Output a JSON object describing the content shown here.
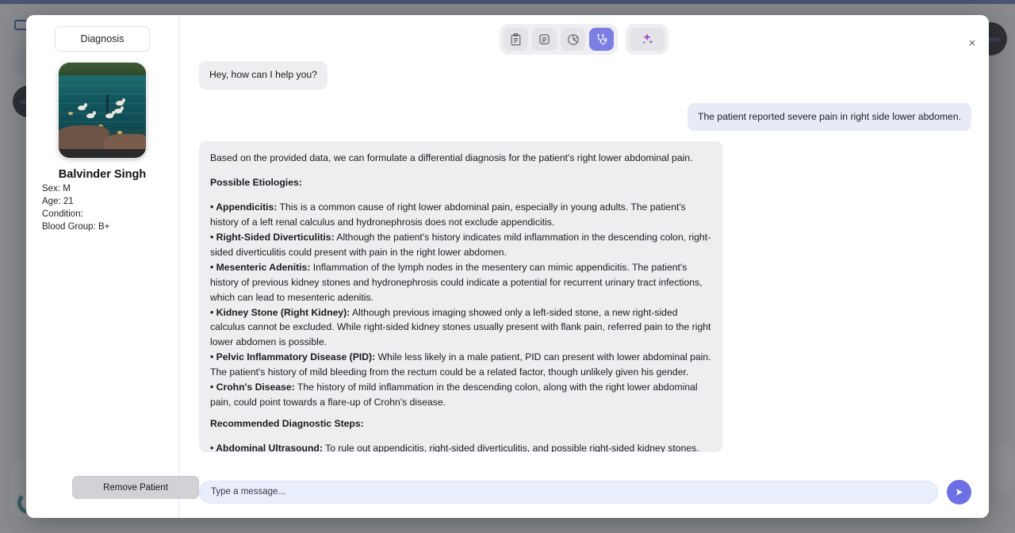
{
  "modal": {
    "close_label": "×"
  },
  "sidebar": {
    "tab_label": "Diagnosis",
    "patient": {
      "name": "Balvinder Singh",
      "photo_alt": "lake-with-ducks-photo",
      "fields": [
        {
          "label": "Sex:",
          "value": "M"
        },
        {
          "label": "Age:",
          "value": "21"
        },
        {
          "label": "Condition:",
          "value": ""
        },
        {
          "label": "Blood Group:",
          "value": "B+"
        }
      ]
    },
    "remove_patient_label": "Remove Patient"
  },
  "toolbar": {
    "tools": [
      {
        "name": "clipboard-report-icon",
        "active": false
      },
      {
        "name": "notes-document-icon",
        "active": false
      },
      {
        "name": "pie-chart-icon",
        "active": false
      },
      {
        "name": "stethoscope-icon",
        "active": true
      }
    ],
    "magic_tool": {
      "name": "ai-sparkle-icon"
    },
    "active_color": "#7b7fe4"
  },
  "chat": {
    "messages": [
      {
        "role": "bot",
        "text": "Hey, how can I help you?"
      },
      {
        "role": "user",
        "text": "The patient reported severe pain in right side lower abdomen."
      }
    ],
    "answer": {
      "intro": "Based on the provided data, we can formulate a differential diagnosis for the patient's right lower abdominal pain.",
      "etiologies_heading": "Possible Etiologies:",
      "etiologies": [
        {
          "term": "• Appendicitis:",
          "text": " This is a common cause of right lower abdominal pain, especially in young adults. The patient's history of a left renal calculus and hydronephrosis does not exclude appendicitis."
        },
        {
          "term": "• Right-Sided Diverticulitis:",
          "text": " Although the patient's history indicates mild inflammation in the descending colon, right-sided diverticulitis could present with pain in the right lower abdomen."
        },
        {
          "term": "• Mesenteric Adenitis:",
          "text": " Inflammation of the lymph nodes in the mesentery can mimic appendicitis. The patient's history of previous kidney stones and hydronephrosis could indicate a potential for recurrent urinary tract infections, which can lead to mesenteric adenitis."
        },
        {
          "term": "• Kidney Stone (Right Kidney):",
          "text": " Although previous imaging showed only a left-sided stone, a new right-sided calculus cannot be excluded. While right-sided kidney stones usually present with flank pain, referred pain to the right lower abdomen is possible."
        },
        {
          "term": "• Pelvic Inflammatory Disease (PID):",
          "text": " While less likely in a male patient, PID can present with lower abdominal pain. The patient's history of mild bleeding from the rectum could be a related factor, though unlikely given his gender."
        },
        {
          "term": "• Crohn's Disease:",
          "text": " The history of mild inflammation in the descending colon, along with the right lower abdominal pain, could point towards a flare-up of Crohn's disease."
        }
      ],
      "steps_heading": "Recommended Diagnostic Steps:",
      "steps": [
        {
          "term": "• Abdominal Ultrasound:",
          "text": " To rule out appendicitis, right-sided diverticulitis, and possible right-sided kidney stones."
        }
      ]
    }
  },
  "composer": {
    "placeholder": "Type a message...",
    "input_value": "",
    "send_icon": "send-arrow-icon",
    "send_color": "#6c70e4"
  }
}
